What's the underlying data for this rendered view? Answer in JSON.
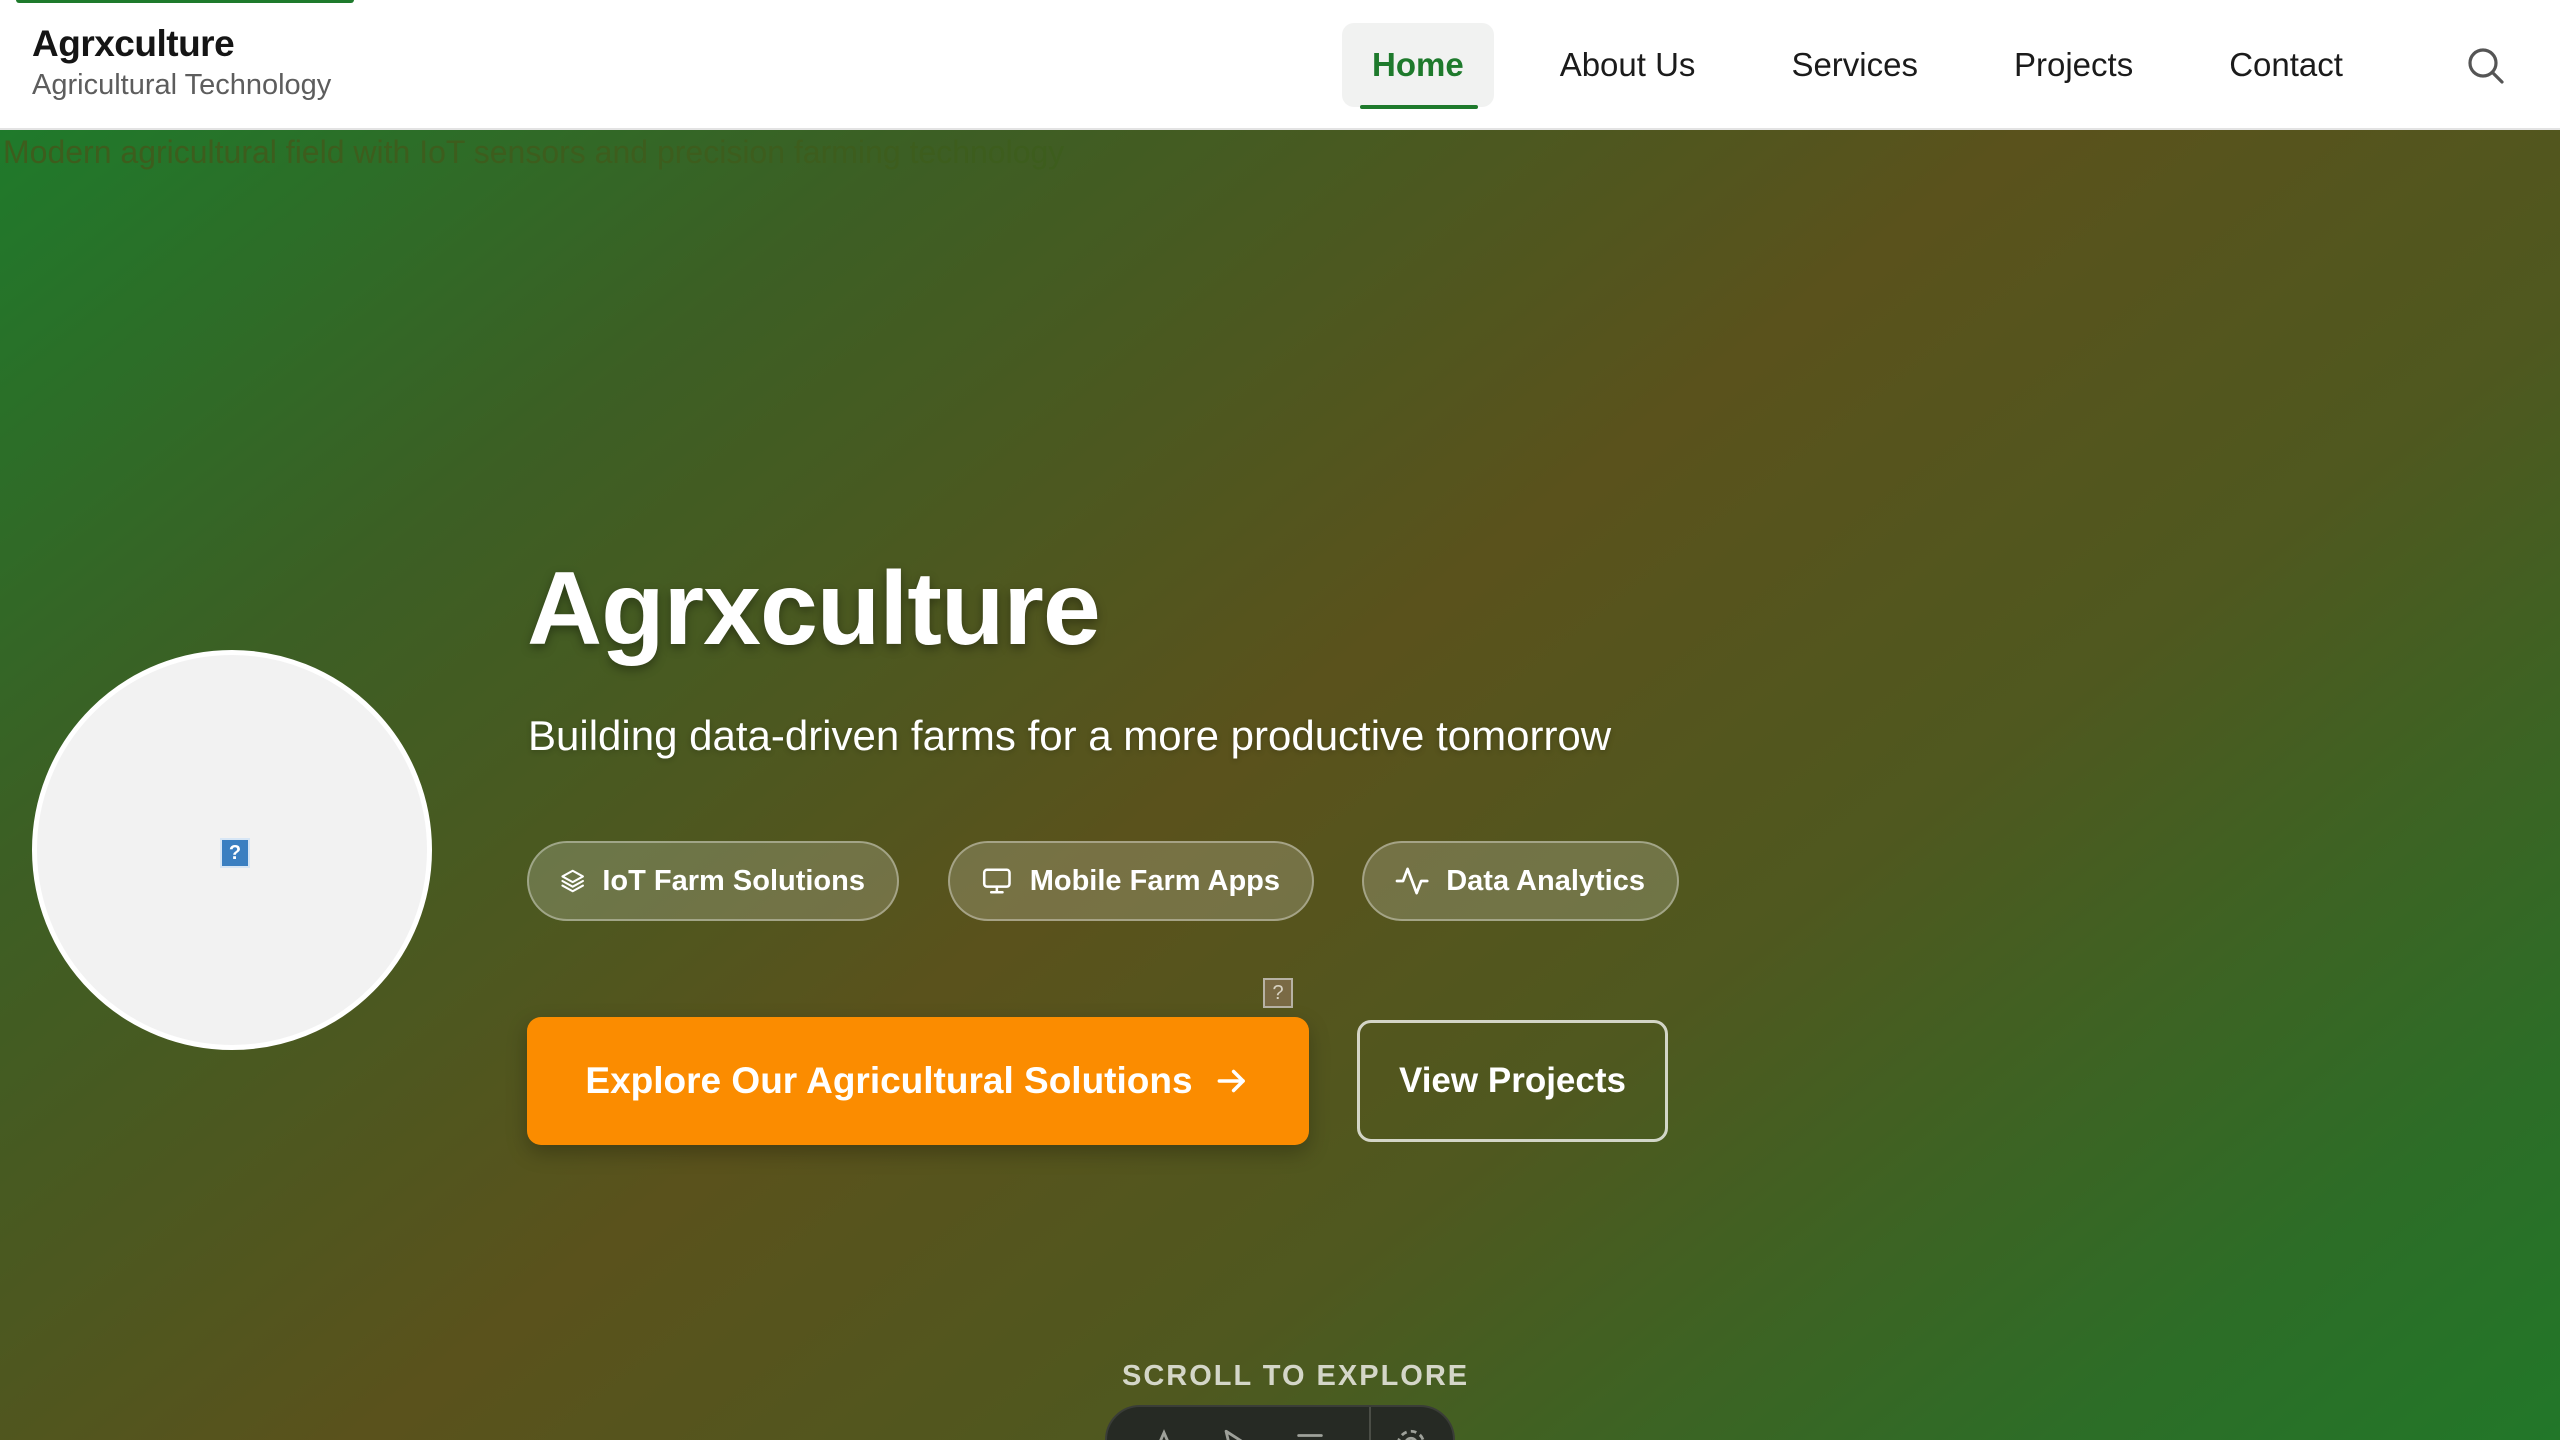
{
  "brand": {
    "title": "Agrxculture",
    "subtitle": "Agricultural Technology",
    "accent_color": "#1e7a2c"
  },
  "nav": {
    "items": [
      {
        "label": "Home",
        "active": true
      },
      {
        "label": "About Us",
        "active": false
      },
      {
        "label": "Services",
        "active": false
      },
      {
        "label": "Projects",
        "active": false
      },
      {
        "label": "Contact",
        "active": false
      }
    ],
    "search_icon": "search-icon"
  },
  "hero": {
    "image_alt": "Modern agricultural field with IoT sensors and precision farming technology",
    "title": "Agrxculture",
    "subtitle": "Building data-driven farms for a more productive tomorrow",
    "badges": [
      {
        "label": "IoT Farm Solutions",
        "icon": "layers-icon"
      },
      {
        "label": "Mobile Farm Apps",
        "icon": "monitor-icon"
      },
      {
        "label": "Data Analytics",
        "icon": "activity-icon"
      }
    ],
    "primary_cta": {
      "label": "Explore Our Agricultural Solutions",
      "icon": "arrow-right-icon",
      "color": "#fb8c00"
    },
    "secondary_cta": {
      "label": "View Projects"
    },
    "scroll_label": "SCROLL TO EXPLORE",
    "broken_image_glyph": "?"
  },
  "colors": {
    "hero_green": "#1f7a2b",
    "hero_brown": "#5a521c",
    "cta_orange": "#fb8c00"
  }
}
